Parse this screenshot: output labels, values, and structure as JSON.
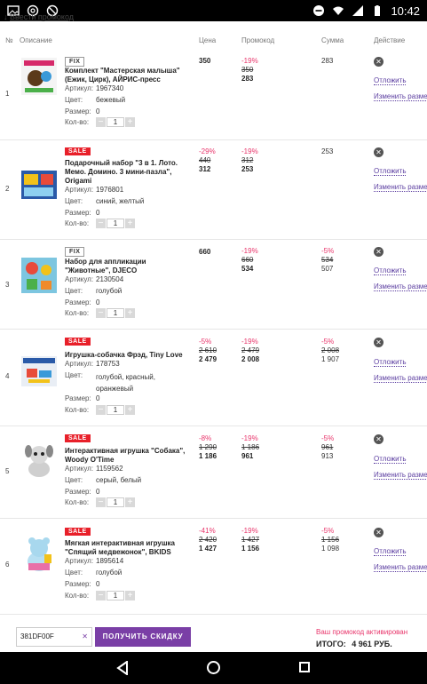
{
  "statusbar": {
    "time": "10:42"
  },
  "promo_link": "Ввести промокод",
  "headers": {
    "num": "№",
    "desc": "Описание",
    "price": "Цена",
    "promo": "Промокод",
    "sum": "Сумма",
    "action": "Действие"
  },
  "labels": {
    "article": "Артикул:",
    "color": "Цвет:",
    "size": "Размер:",
    "qty": "Кол-во:",
    "delete": "Отложить",
    "change_size": "Изменить разме"
  },
  "items": [
    {
      "num": "1",
      "tag": "FIX",
      "title": "Комплект \"Мастерская малыша\" (Ежик, Цирк), АЙРИС-пресс",
      "article": "1967340",
      "color": "бежевый",
      "size": "0",
      "qty": "1",
      "price_new": "350",
      "promo_disc": "-19%",
      "promo_old": "350",
      "promo_new": "283",
      "sum": "283"
    },
    {
      "num": "2",
      "tag": "SALE",
      "title": "Подарочный набор \"3 в 1. Лото. Мемо. Домино. 3 мини-пазла\", Origami",
      "article": "1976801",
      "color": "синий, желтый",
      "size": "0",
      "qty": "1",
      "price_disc": "-29%",
      "price_old": "440",
      "price_new": "312",
      "promo_disc": "-19%",
      "promo_old": "312",
      "promo_new": "253",
      "sum": "253"
    },
    {
      "num": "3",
      "tag": "FIX",
      "title": "Набор для аппликации \"Животные\", DJECO",
      "article": "2130504",
      "color": "голубой",
      "size": "0",
      "qty": "1",
      "price_new": "660",
      "promo_disc": "-19%",
      "promo_old": "660",
      "promo_new": "534",
      "sum_disc": "-5%",
      "sum_old": "534",
      "sum": "507"
    },
    {
      "num": "4",
      "tag": "SALE",
      "title": "Игрушка-собачка Фрэд, Tiny Love",
      "article": "178753",
      "color": "голубой, красный, оранжевый",
      "size": "0",
      "qty": "1",
      "price_disc": "-5%",
      "price_old": "2 610",
      "price_new": "2 479",
      "promo_disc": "-19%",
      "promo_old": "2 479",
      "promo_new": "2 008",
      "sum_disc": "-5%",
      "sum_old": "2 008",
      "sum": "1 907"
    },
    {
      "num": "5",
      "tag": "SALE",
      "title": "Интерактивная игрушка \"Собака\", Woody O'Time",
      "article": "1159562",
      "color": "серый, белый",
      "size": "0",
      "qty": "1",
      "price_disc": "-8%",
      "price_old": "1 290",
      "price_new": "1 186",
      "promo_disc": "-19%",
      "promo_old": "1 186",
      "promo_new": "961",
      "sum_disc": "-5%",
      "sum_old": "961",
      "sum": "913"
    },
    {
      "num": "6",
      "tag": "SALE",
      "title": "Мягкая интерактивная игрушка \"Спящий медвежонок\", BKIDS",
      "article": "1895614",
      "color": "голубой",
      "size": "0",
      "qty": "1",
      "price_disc": "-41%",
      "price_old": "2 420",
      "price_new": "1 427",
      "promo_disc": "-19%",
      "promo_old": "1 427",
      "promo_new": "1 156",
      "sum_disc": "-5%",
      "sum_old": "1 156",
      "sum": "1 098"
    }
  ],
  "bottom": {
    "promo_code": "381DF00F",
    "apply_label": "ПОЛУЧИТЬ СКИДКУ",
    "activated": "Ваш промокод активирован",
    "total_label": "ИТОГО:",
    "total_value": "4 961 РУБ."
  }
}
